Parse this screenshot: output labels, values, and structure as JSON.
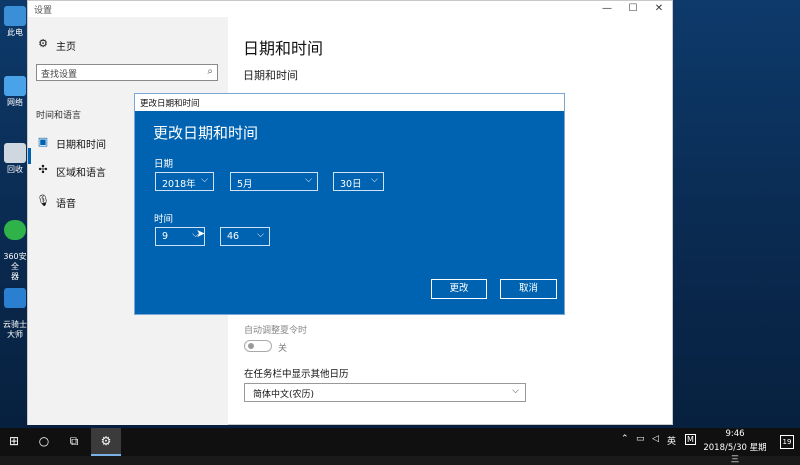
{
  "desktop": {
    "icons": [
      {
        "label": "此电",
        "color": "#3a8fd6"
      },
      {
        "label": "网络",
        "color": "#4aa3e8"
      },
      {
        "label": "回收",
        "color": "#cfd8e0"
      },
      {
        "label": "360安全\n器",
        "color": "#2fb24a"
      },
      {
        "label": "云骑士\n大师",
        "color": "#2a7fd0"
      }
    ]
  },
  "window": {
    "title": "设置",
    "controls": {
      "minimize": "—",
      "maximize": "☐",
      "close": "✕"
    }
  },
  "nav": {
    "home": {
      "icon": "gear-icon",
      "label": "主页"
    },
    "search": {
      "placeholder": "查找设置",
      "icon": "search-icon"
    },
    "group_label": "时间和语言",
    "items": [
      {
        "icon": "calendar-clock-icon",
        "label": "日期和时间",
        "active": true
      },
      {
        "icon": "region-language-icon",
        "label": "区域和语言",
        "active": false
      },
      {
        "icon": "microphone-icon",
        "label": "语音",
        "active": false
      }
    ]
  },
  "main": {
    "page_title": "日期和时间",
    "section_title": "日期和时间",
    "dst_label": "自动调整夏令时",
    "toggle_state": "关",
    "calendar_label": "在任务栏中显示其他日历",
    "calendar_value": "简体中文(农历)"
  },
  "dialog": {
    "title": "更改日期和时间",
    "heading": "更改日期和时间",
    "date_label": "日期",
    "year": "2018年",
    "month": "5月",
    "day": "30日",
    "time_label": "时间",
    "hour": "9",
    "minute": "46",
    "change_button": "更改",
    "cancel_button": "取消"
  },
  "taskbar": {
    "tray": {
      "lang": "英",
      "ime": "M"
    },
    "time": "9:46",
    "date": "2018/5/30 星期三",
    "notifications": "19"
  },
  "colors": {
    "accent": "#0063b1",
    "dialog_border": "#7aa7d6"
  }
}
